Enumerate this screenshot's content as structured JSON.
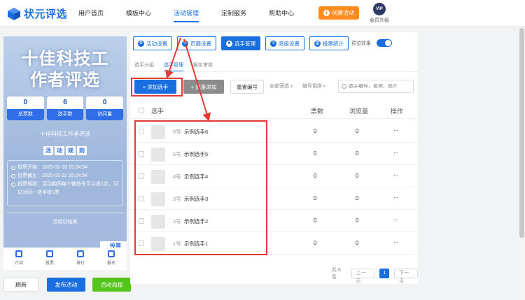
{
  "brand": {
    "name": "状元评选"
  },
  "nav": [
    {
      "label": "用户首页",
      "active": false
    },
    {
      "label": "模板中心",
      "active": false
    },
    {
      "label": "活动管理",
      "active": true
    },
    {
      "label": "定制服务",
      "active": false
    },
    {
      "label": "帮助中心",
      "active": false
    }
  ],
  "header": {
    "create_label": "创建活动",
    "vip_badge": "VIP",
    "vip_label": "会员升级"
  },
  "preview": {
    "title_line1": "十佳科技工",
    "title_line2": "作者评选",
    "stats": [
      {
        "value": "0",
        "label": "总票数"
      },
      {
        "value": "6",
        "label": "选手数"
      },
      {
        "value": "0",
        "label": "访问量"
      }
    ],
    "subtitle": "十佳科技工作者评选",
    "rules_chars": [
      "活",
      "动",
      "规",
      "则"
    ],
    "rules": [
      "投票开始：2025-01-16 15:24:54",
      "投票截止：2025-01-22 15:24:54",
      "投票规则：活动期间每个微信号可以投1次，可以对同一选手投1票"
    ],
    "ended": "活动已结束",
    "vote_button": "投票",
    "tabs": [
      "介绍",
      "投票",
      "排行",
      "报名"
    ]
  },
  "bottom": {
    "refresh": "刷新",
    "publish": "发布活动",
    "poster": "活动海报"
  },
  "toolbar": [
    {
      "label": "活动设置",
      "icon": "gear-icon",
      "active": false
    },
    {
      "label": "页面设置",
      "icon": "gear-icon",
      "active": false
    },
    {
      "label": "选手管理",
      "icon": "users-icon",
      "active": true
    },
    {
      "label": "高级设置",
      "icon": "sliders-icon",
      "active": false
    },
    {
      "label": "投票统计",
      "icon": "chart-icon",
      "active": false
    }
  ],
  "preview_toggle": {
    "label": "预览效果",
    "on": true
  },
  "subtabs": [
    {
      "label": "选手分组",
      "active": false
    },
    {
      "label": "选手管理",
      "active": true
    },
    {
      "label": "报名审核",
      "active": false
    }
  ],
  "actions": {
    "add": "+ 添加选手",
    "batch": "+ 批量添加",
    "reset": "重置编号",
    "filter_group": "全部筛选",
    "sort": "编号倒序",
    "search_placeholder": "选手编号、名称、简介"
  },
  "table": {
    "headers": {
      "name": "选手",
      "votes": "票数",
      "views": "浏览量",
      "ops": "操作"
    },
    "rows": [
      {
        "num": "6号",
        "name": "示例选手6",
        "votes": "0",
        "views": "0",
        "more": "···"
      },
      {
        "num": "5号",
        "name": "示例选手5",
        "votes": "0",
        "views": "0",
        "more": "···"
      },
      {
        "num": "4号",
        "name": "示例选手4",
        "votes": "0",
        "views": "0",
        "more": "···"
      },
      {
        "num": "3号",
        "name": "示例选手3",
        "votes": "0",
        "views": "0",
        "more": "···"
      },
      {
        "num": "2号",
        "name": "示例选手2",
        "votes": "0",
        "views": "0",
        "more": "···"
      },
      {
        "num": "1号",
        "name": "示例选手1",
        "votes": "0",
        "views": "0",
        "more": "···"
      }
    ]
  },
  "pager": {
    "total": "共 6 条",
    "prev": "上一页",
    "current": "1",
    "next": "下一页"
  },
  "colors": {
    "accent": "#1a6fe0",
    "orange": "#ff8a1e",
    "green": "#52c41a",
    "annotation": "#e53935"
  }
}
